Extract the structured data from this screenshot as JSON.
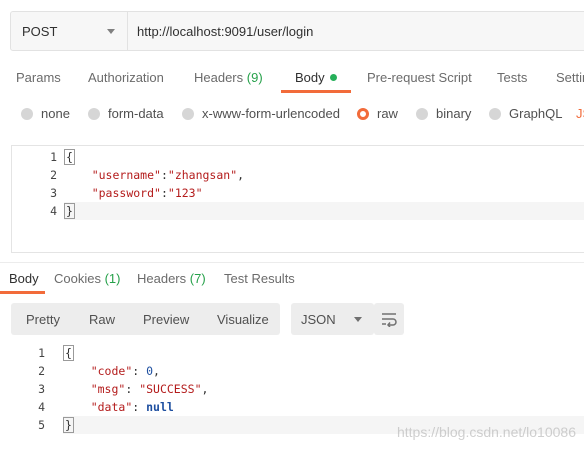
{
  "request": {
    "method": "POST",
    "url": "http://localhost:9091/user/login"
  },
  "request_tabs": [
    {
      "label": "Params"
    },
    {
      "label": "Authorization"
    },
    {
      "label": "Headers",
      "count": "(9)"
    },
    {
      "label": "Body"
    },
    {
      "label": "Pre-request Script"
    },
    {
      "label": "Tests"
    },
    {
      "label": "Settin"
    }
  ],
  "body_types": [
    {
      "label": "none"
    },
    {
      "label": "form-data"
    },
    {
      "label": "x-www-form-urlencoded"
    },
    {
      "label": "raw"
    },
    {
      "label": "binary"
    },
    {
      "label": "GraphQL"
    },
    {
      "label": "JS"
    }
  ],
  "request_body": {
    "line_numbers": [
      "1",
      "2",
      "3",
      "4"
    ],
    "open_brace": "{",
    "close_brace": "}",
    "username_key": "\"username\"",
    "username_val": "\"zhangsan\"",
    "password_key": "\"password\"",
    "password_val": "\"123\""
  },
  "response_tabs": [
    {
      "label": "Body"
    },
    {
      "label": "Cookies",
      "count": "(1)"
    },
    {
      "label": "Headers",
      "count": "(7)"
    },
    {
      "label": "Test Results"
    }
  ],
  "response_views": [
    "Pretty",
    "Raw",
    "Preview",
    "Visualize"
  ],
  "response_format": "JSON",
  "response_body": {
    "line_numbers": [
      "1",
      "2",
      "3",
      "4",
      "5"
    ],
    "open_brace": "{",
    "close_brace": "}",
    "code_key": "\"code\"",
    "code_val": "0",
    "msg_key": "\"msg\"",
    "msg_val": "\"SUCCESS\"",
    "data_key": "\"data\"",
    "data_val": "null"
  },
  "watermark": "https://blog.csdn.net/lo10086",
  "colors": {
    "accent": "#f26b3a",
    "count": "#26a14a",
    "dot": "#26b05a"
  }
}
